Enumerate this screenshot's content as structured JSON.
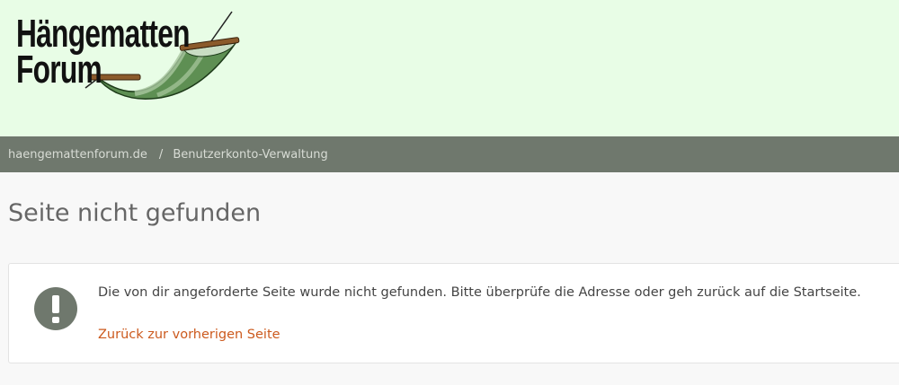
{
  "header": {
    "logo_line1": "Hängematten",
    "logo_line2": "Forum"
  },
  "breadcrumb": {
    "home": "haengematten­forum.de",
    "separator": "/",
    "current": "Benutzerkonto-Verwaltung"
  },
  "main": {
    "title": "Seite nicht gefunden",
    "notice": {
      "icon": "exclamation-icon",
      "message": "Die von dir angeforderte Seite wurde nicht gefunden. Bitte überprüfe die Adresse oder geh zurück auf die Startseite.",
      "back_link": "Zurück zur vorherigen Seite"
    }
  },
  "colors": {
    "header_bg": "#e8fde6",
    "nav_bg": "#6f786d",
    "link": "#cc5a1e"
  }
}
